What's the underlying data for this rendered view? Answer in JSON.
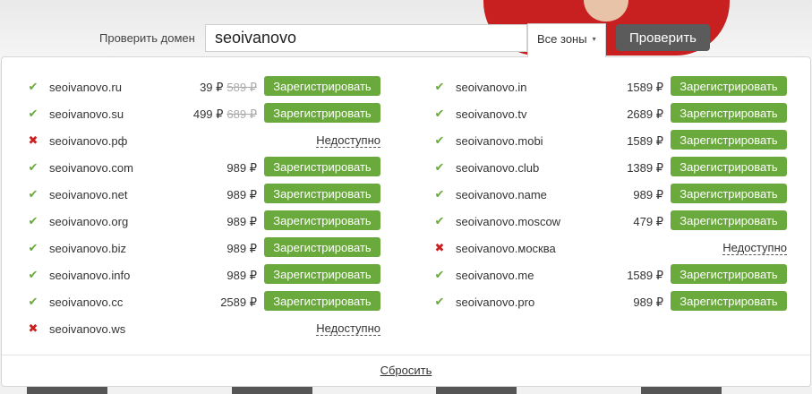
{
  "search": {
    "label": "Проверить домен",
    "value": "seoivanovo",
    "zone_label": "Все зоны",
    "caret": "▾",
    "submit_label": "Проверить"
  },
  "results": {
    "left": [
      {
        "domain": "seoivanovo.ru",
        "available": true,
        "price": "39 ₽",
        "old_price": "589 ₽",
        "action": "Зарегистрировать"
      },
      {
        "domain": "seoivanovo.su",
        "available": true,
        "price": "499 ₽",
        "old_price": "689 ₽",
        "action": "Зарегистрировать"
      },
      {
        "domain": "seoivanovo.рф",
        "available": false,
        "price": "",
        "old_price": "",
        "action": "Недоступно"
      },
      {
        "domain": "seoivanovo.com",
        "available": true,
        "price": "989 ₽",
        "old_price": "",
        "action": "Зарегистрировать"
      },
      {
        "domain": "seoivanovo.net",
        "available": true,
        "price": "989 ₽",
        "old_price": "",
        "action": "Зарегистрировать"
      },
      {
        "domain": "seoivanovo.org",
        "available": true,
        "price": "989 ₽",
        "old_price": "",
        "action": "Зарегистрировать"
      },
      {
        "domain": "seoivanovo.biz",
        "available": true,
        "price": "989 ₽",
        "old_price": "",
        "action": "Зарегистрировать"
      },
      {
        "domain": "seoivanovo.info",
        "available": true,
        "price": "989 ₽",
        "old_price": "",
        "action": "Зарегистрировать"
      },
      {
        "domain": "seoivanovo.cc",
        "available": true,
        "price": "2589 ₽",
        "old_price": "",
        "action": "Зарегистрировать"
      },
      {
        "domain": "seoivanovo.ws",
        "available": false,
        "price": "",
        "old_price": "",
        "action": "Недоступно"
      }
    ],
    "right": [
      {
        "domain": "seoivanovo.in",
        "available": true,
        "price": "1589 ₽",
        "old_price": "",
        "action": "Зарегистрировать"
      },
      {
        "domain": "seoivanovo.tv",
        "available": true,
        "price": "2689 ₽",
        "old_price": "",
        "action": "Зарегистрировать"
      },
      {
        "domain": "seoivanovo.mobi",
        "available": true,
        "price": "1589 ₽",
        "old_price": "",
        "action": "Зарегистрировать"
      },
      {
        "domain": "seoivanovo.club",
        "available": true,
        "price": "1389 ₽",
        "old_price": "",
        "action": "Зарегистрировать"
      },
      {
        "domain": "seoivanovo.name",
        "available": true,
        "price": "989 ₽",
        "old_price": "",
        "action": "Зарегистрировать"
      },
      {
        "domain": "seoivanovo.moscow",
        "available": true,
        "price": "479 ₽",
        "old_price": "",
        "action": "Зарегистрировать"
      },
      {
        "domain": "seoivanovo.москва",
        "available": false,
        "price": "",
        "old_price": "",
        "action": "Недоступно"
      },
      {
        "domain": "seoivanovo.me",
        "available": true,
        "price": "1589 ₽",
        "old_price": "",
        "action": "Зарегистрировать"
      },
      {
        "domain": "seoivanovo.pro",
        "available": true,
        "price": "989 ₽",
        "old_price": "",
        "action": "Зарегистрировать"
      }
    ]
  },
  "icons": {
    "available": "check-icon",
    "unavailable": "cross-icon",
    "available_glyph": "✔",
    "unavailable_glyph": "✖"
  },
  "colors": {
    "register_button": "#6aa93b",
    "check_mark": "#6aa93b",
    "cross_mark": "#cc1e1e",
    "submit_button": "#5b5b5b"
  },
  "footer": {
    "reset_label": "Сбросить"
  }
}
